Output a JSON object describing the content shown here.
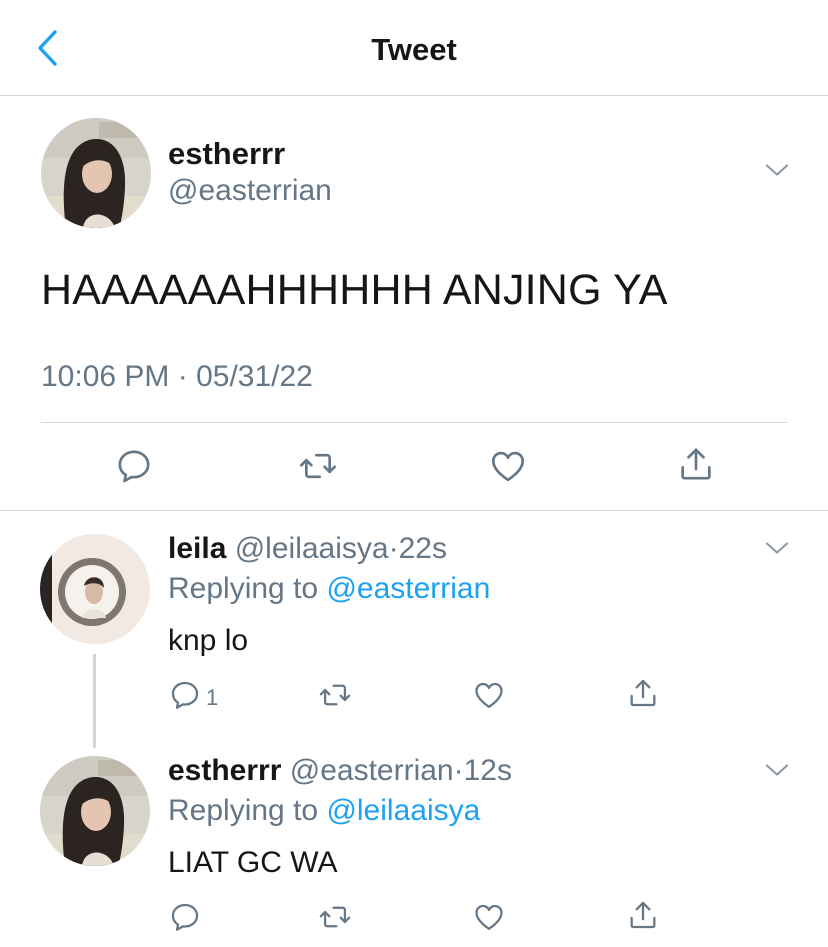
{
  "header": {
    "title": "Tweet",
    "back_icon": "chevron-left-icon",
    "accent": "#1da1f2"
  },
  "tweet": {
    "name": "estherrr",
    "handle": "@easterrian",
    "text": "HAAAAAAHHHHHH ANJING YA",
    "time": "10:06 PM · 05/31/22",
    "actions": [
      "reply-icon",
      "retweet-icon",
      "like-icon",
      "share-icon"
    ]
  },
  "replies": [
    {
      "name": "leila",
      "handle": "@leilaaisya",
      "sep": "·",
      "age": "22s",
      "replying_label": "Replying to",
      "replying_to": "@easterrian",
      "text": "knp lo",
      "reply_count": "1"
    },
    {
      "name": "estherrr",
      "handle": "@easterrian",
      "sep": "·",
      "age": "12s",
      "replying_label": "Replying to",
      "replying_to": "@leilaaisya",
      "text": "LIAT GC WA",
      "reply_count": ""
    }
  ]
}
